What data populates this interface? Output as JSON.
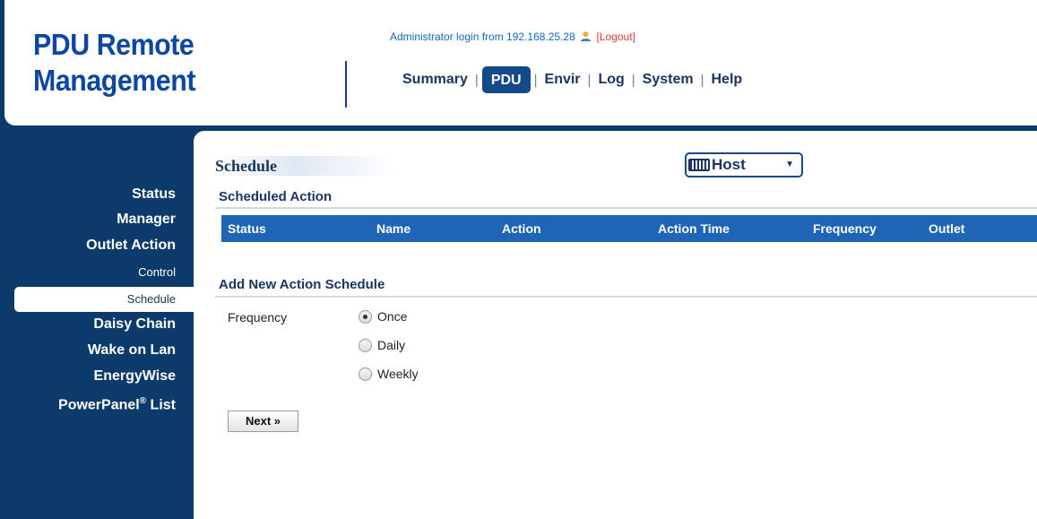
{
  "header": {
    "logo_line1": "PDU Remote",
    "logo_line2": "Management",
    "login_prefix": "Administrator login from 192.168.25.28",
    "logout_label": "[Logout]",
    "nav": [
      "Summary",
      "PDU",
      "Envir",
      "Log",
      "System",
      "Help"
    ],
    "active_nav": "PDU",
    "separator": "|"
  },
  "sidebar": {
    "status": "Status",
    "manager": "Manager",
    "outlet_action": "Outlet Action",
    "control": "Control",
    "schedule": "Schedule",
    "daisy_chain": "Daisy Chain",
    "wake_on_lan": "Wake on Lan",
    "energywise": "EnergyWise",
    "powerpanel": "PowerPanel",
    "powerpanel_reg": "®",
    "powerpanel_suffix": "List"
  },
  "main": {
    "title": "Schedule",
    "host_select": "Host",
    "scheduled_action_heading": "Scheduled Action",
    "table_columns": [
      "Status",
      "Name",
      "Action",
      "Action Time",
      "Frequency",
      "Outlet"
    ],
    "add_heading": "Add New Action Schedule",
    "frequency_label": "Frequency",
    "frequency_options": [
      "Once",
      "Daily",
      "Weekly"
    ],
    "frequency_selected": "Once",
    "next_button": "Next »"
  },
  "colors": {
    "brand_navy": "#0c3a6b",
    "logo_blue": "#0d47a1",
    "table_header": "#1f65b5",
    "logout_red": "#e53935"
  }
}
